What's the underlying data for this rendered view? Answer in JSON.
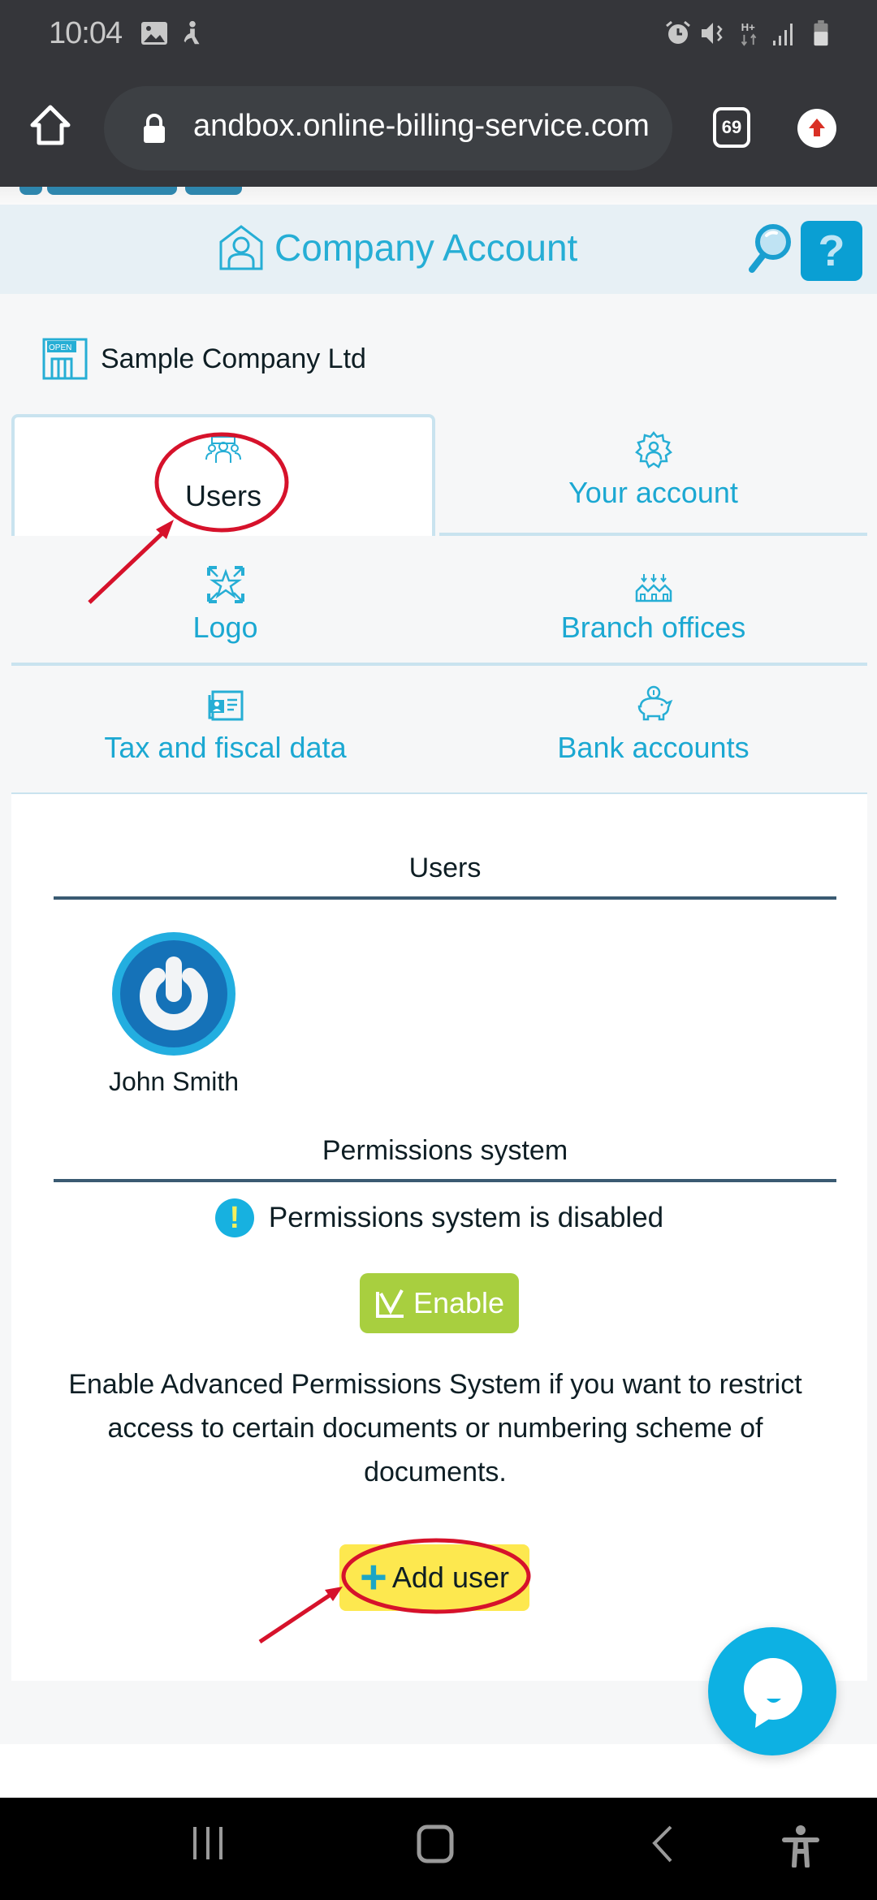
{
  "status_bar": {
    "time": "10:04",
    "left_icons": [
      "gallery-icon",
      "accessibility-notification-icon"
    ],
    "right_icons": [
      "alarm-icon",
      "vibrate-icon",
      "h-plus-data-icon",
      "signal-icon",
      "battery-icon"
    ]
  },
  "browser": {
    "url": "andbox.online-billing-service.com",
    "tab_count": "69",
    "home_icon": "home-icon",
    "lock_icon": "lock-icon",
    "update_icon": "update-arrow-icon"
  },
  "header": {
    "title": "Company Account",
    "help_label": "?",
    "accent_color": "#26aed5"
  },
  "company": {
    "name": "Sample Company Ltd",
    "icon": "shop-open-icon"
  },
  "tabs": [
    {
      "label": "Users",
      "icon": "users-group-icon",
      "active": true
    },
    {
      "label": "Your account",
      "icon": "user-gear-icon",
      "active": false
    },
    {
      "label": "Logo",
      "icon": "logo-star-icon",
      "active": false
    },
    {
      "label": "Branch offices",
      "icon": "branch-houses-icon",
      "active": false
    },
    {
      "label": "Tax and fiscal data",
      "icon": "tax-document-icon",
      "active": false
    },
    {
      "label": "Bank accounts",
      "icon": "piggy-bank-icon",
      "active": false
    }
  ],
  "users_section": {
    "title": "Users",
    "users": [
      {
        "name": "John Smith"
      }
    ]
  },
  "permissions": {
    "title": "Permissions system",
    "status": "Permissions system is disabled",
    "enable_label": "Enable",
    "description": "Enable Advanced Permissions System if you want to restrict access to certain documents or numbering scheme of documents.",
    "enable_color": "#a8cf3f"
  },
  "actions": {
    "add_user_label": "Add user",
    "add_user_color": "#fde84f"
  },
  "annotations": {
    "highlight_color": "#d6122b"
  },
  "nav_bar": {
    "icons": [
      "recent-apps-icon",
      "home-nav-icon",
      "back-icon",
      "accessibility-icon"
    ]
  }
}
